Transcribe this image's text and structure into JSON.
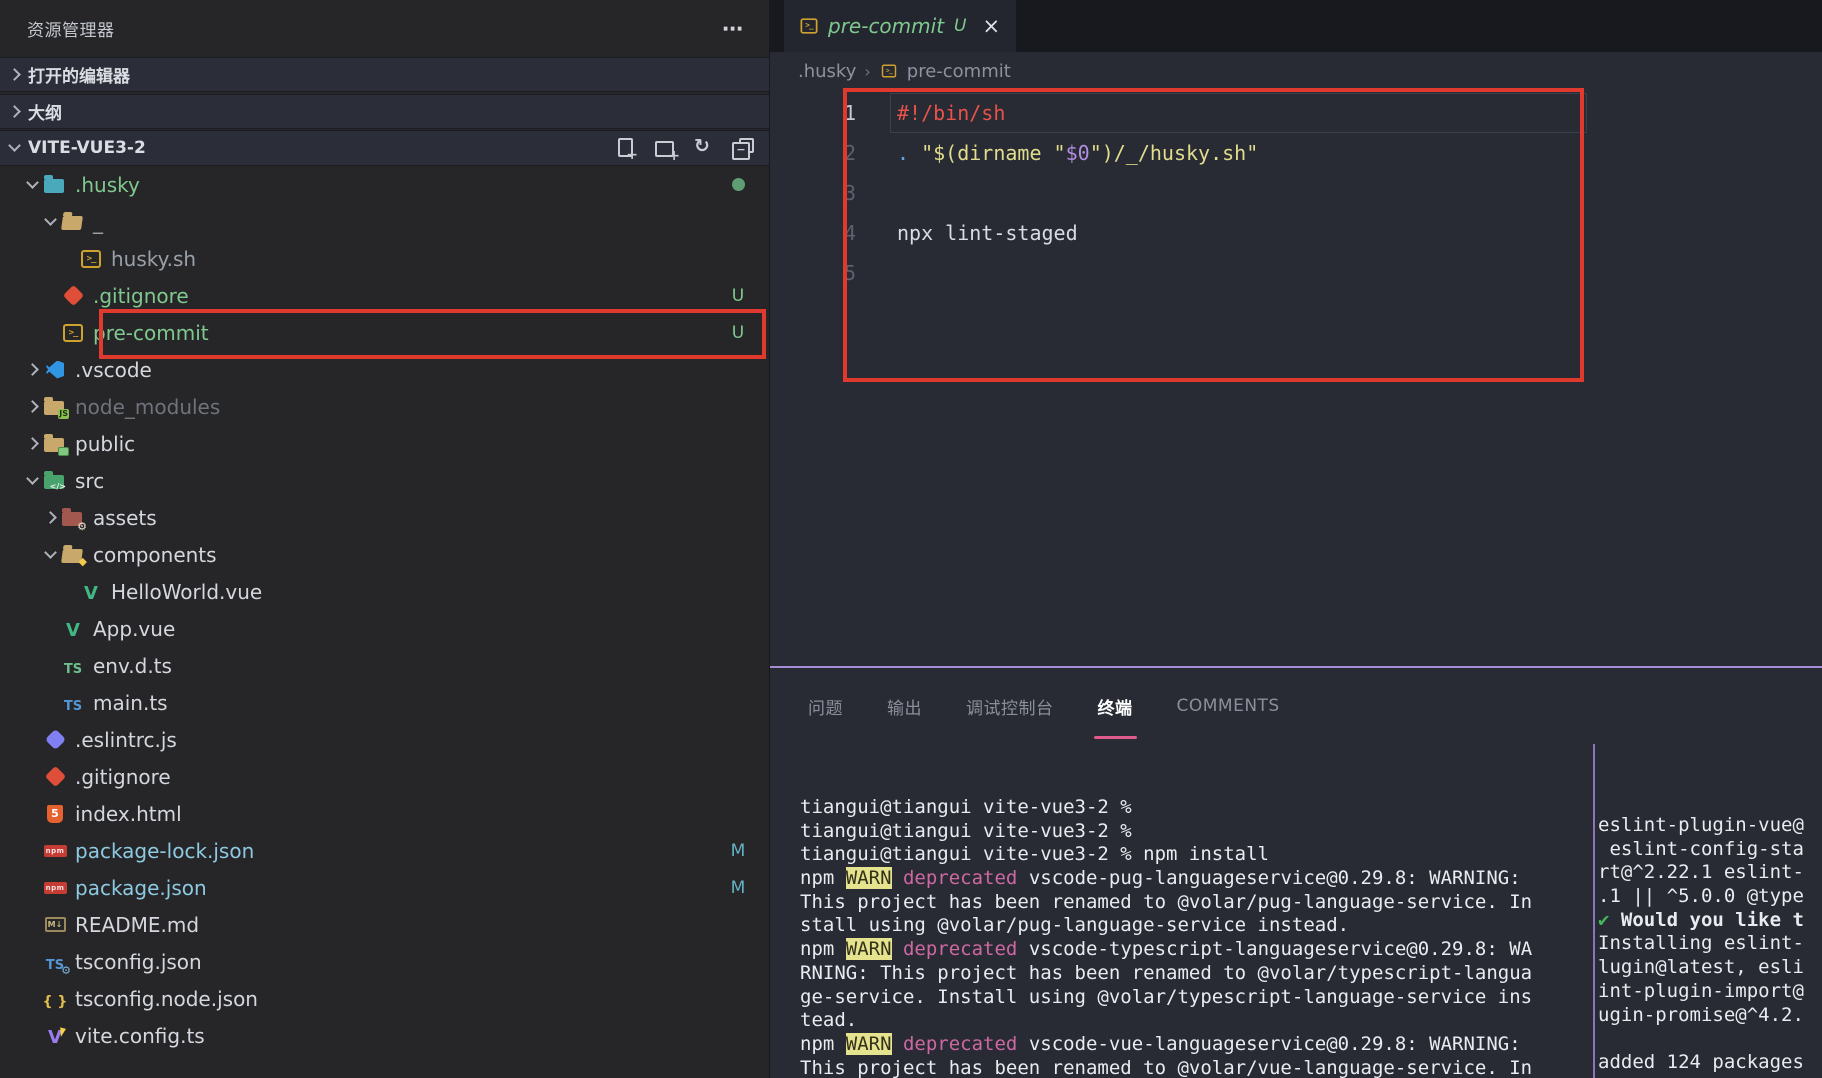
{
  "sidebar": {
    "title": "资源管理器",
    "more_actions": "⋯",
    "sections": [
      {
        "label": "打开的编辑器"
      },
      {
        "label": "大纲"
      }
    ],
    "project": {
      "label": "VITE-VUE3-2"
    },
    "toolbar": [
      {
        "name": "new-file",
        "cls": "newfile"
      },
      {
        "name": "new-folder",
        "cls": "newfolder"
      },
      {
        "name": "refresh",
        "cls": "refresh"
      },
      {
        "name": "collapse-all",
        "cls": "collapse"
      }
    ],
    "tree": [
      {
        "label": ".husky",
        "level": 1,
        "icon": "folder-husky",
        "state": "expanded",
        "color": "green",
        "badge": "dot"
      },
      {
        "label": "_",
        "level": 2,
        "icon": "folder-open",
        "state": "expanded",
        "color": "dim"
      },
      {
        "label": "husky.sh",
        "level": 3,
        "icon": "shell",
        "color": "dim"
      },
      {
        "label": ".gitignore",
        "level": 2,
        "icon": "git",
        "color": "green",
        "badge": "U"
      },
      {
        "label": "pre-commit",
        "level": 2,
        "icon": "shell",
        "color": "green",
        "badge": "U"
      },
      {
        "label": ".vscode",
        "level": 1,
        "icon": "vscode",
        "state": "collapsed",
        "color": "white"
      },
      {
        "label": "node_modules",
        "level": 1,
        "icon": "folder-npm",
        "state": "collapsed",
        "color": "ignored"
      },
      {
        "label": "public",
        "level": 1,
        "icon": "folder-public",
        "state": "collapsed",
        "color": "white"
      },
      {
        "label": "src",
        "level": 1,
        "icon": "folder-src",
        "state": "expanded",
        "color": "white"
      },
      {
        "label": "assets",
        "level": 2,
        "icon": "folder-assets",
        "state": "collapsed",
        "color": "white"
      },
      {
        "label": "components",
        "level": 2,
        "icon": "folder-components",
        "state": "expanded",
        "color": "white"
      },
      {
        "label": "HelloWorld.vue",
        "level": 3,
        "icon": "vue",
        "color": "white"
      },
      {
        "label": "App.vue",
        "level": 2,
        "icon": "vue",
        "color": "white"
      },
      {
        "label": "env.d.ts",
        "level": 2,
        "icon": "ts-green",
        "color": "white"
      },
      {
        "label": "main.ts",
        "level": 2,
        "icon": "ts-blue",
        "color": "white"
      },
      {
        "label": ".eslintrc.js",
        "level": 1,
        "icon": "eslint",
        "color": "white"
      },
      {
        "label": ".gitignore",
        "level": 1,
        "icon": "git",
        "color": "white"
      },
      {
        "label": "index.html",
        "level": 1,
        "icon": "html",
        "color": "white"
      },
      {
        "label": "package-lock.json",
        "level": 1,
        "icon": "npm",
        "color": "modified",
        "badge": "M"
      },
      {
        "label": "package.json",
        "level": 1,
        "icon": "npm",
        "color": "modified",
        "badge": "M"
      },
      {
        "label": "README.md",
        "level": 1,
        "icon": "markdown",
        "color": "white"
      },
      {
        "label": "tsconfig.json",
        "level": 1,
        "icon": "ts-gear",
        "color": "white"
      },
      {
        "label": "tsconfig.node.json",
        "level": 1,
        "icon": "braces",
        "color": "white"
      },
      {
        "label": "vite.config.ts",
        "level": 1,
        "icon": "vite",
        "color": "white"
      }
    ]
  },
  "editor": {
    "tab": {
      "label": "pre-commit",
      "git_status": "U",
      "close": "×"
    },
    "breadcrumb": {
      "folder": ".husky",
      "separator": "›",
      "file": "pre-commit"
    },
    "code": [
      {
        "num": "1",
        "active": true,
        "tokens": [
          {
            "style": "comment-red",
            "text": "#!/bin/sh"
          }
        ]
      },
      {
        "num": "2",
        "tokens": [
          {
            "style": "keyword-blue",
            "text": ". "
          },
          {
            "style": "string",
            "text": "\"$(dirname \""
          },
          {
            "style": "variable",
            "text": "$0"
          },
          {
            "style": "string",
            "text": "\")/_/husky.sh\""
          }
        ]
      },
      {
        "num": "3",
        "tokens": []
      },
      {
        "num": "4",
        "tokens": [
          {
            "style": "plain",
            "text": "npx lint-staged"
          }
        ]
      },
      {
        "num": "5",
        "tokens": []
      }
    ]
  },
  "panel": {
    "tabs": [
      {
        "label": "问题"
      },
      {
        "label": "输出"
      },
      {
        "label": "调试控制台"
      },
      {
        "label": "终端",
        "active": true
      },
      {
        "label": "COMMENTS"
      }
    ],
    "terminal_main": [
      [
        {
          "s": "p",
          "t": "tiangui@tiangui vite-vue3-2 %"
        }
      ],
      [
        {
          "s": "p",
          "t": "tiangui@tiangui vite-vue3-2 %"
        }
      ],
      [
        {
          "s": "p",
          "t": "tiangui@tiangui vite-vue3-2 % npm install"
        }
      ],
      [
        {
          "s": "p",
          "t": "npm "
        },
        {
          "s": "w",
          "t": "WARN"
        },
        {
          "s": "p",
          "t": " "
        },
        {
          "s": "d",
          "t": "deprecated"
        },
        {
          "s": "p",
          "t": " vscode-pug-languageservice@0.29.8: WARNING:"
        }
      ],
      [
        {
          "s": "p",
          "t": "This project has been renamed to @volar/pug-language-service. In"
        }
      ],
      [
        {
          "s": "p",
          "t": "stall using @volar/pug-language-service instead."
        }
      ],
      [
        {
          "s": "p",
          "t": "npm "
        },
        {
          "s": "w",
          "t": "WARN"
        },
        {
          "s": "p",
          "t": " "
        },
        {
          "s": "d",
          "t": "deprecated"
        },
        {
          "s": "p",
          "t": " vscode-typescript-languageservice@0.29.8: WA"
        }
      ],
      [
        {
          "s": "p",
          "t": "RNING: This project has been renamed to @volar/typescript-langua"
        }
      ],
      [
        {
          "s": "p",
          "t": "ge-service. Install using @volar/typescript-language-service ins"
        }
      ],
      [
        {
          "s": "p",
          "t": "tead."
        }
      ],
      [
        {
          "s": "p",
          "t": "npm "
        },
        {
          "s": "w",
          "t": "WARN"
        },
        {
          "s": "p",
          "t": " "
        },
        {
          "s": "d",
          "t": "deprecated"
        },
        {
          "s": "p",
          "t": " vscode-vue-languageservice@0.29.8: WARNING:"
        }
      ],
      [
        {
          "s": "p",
          "t": "This project has been renamed to @volar/vue-language-service. In"
        }
      ]
    ],
    "terminal_right": [
      [
        {
          "s": "p",
          "t": "eslint-plugin-vue@"
        }
      ],
      [
        {
          "s": "p",
          "t": " eslint-config-sta"
        }
      ],
      [
        {
          "s": "p",
          "t": "rt@^2.22.1 eslint-"
        }
      ],
      [
        {
          "s": "p",
          "t": ".1 || ^5.0.0 @type"
        }
      ],
      [
        {
          "s": "g",
          "t": "✔"
        },
        {
          "s": "b",
          "t": " Would you like t"
        }
      ],
      [
        {
          "s": "p",
          "t": "Installing eslint-"
        }
      ],
      [
        {
          "s": "p",
          "t": "lugin@latest, esli"
        }
      ],
      [
        {
          "s": "p",
          "t": "int-plugin-import@"
        }
      ],
      [
        {
          "s": "p",
          "t": "ugin-promise@^4.2."
        }
      ],
      [
        {
          "s": "p",
          "t": ""
        }
      ],
      [
        {
          "s": "p",
          "t": "added 124 packages"
        }
      ]
    ]
  },
  "annotations": {
    "highlight_color": "#e03a2e"
  }
}
